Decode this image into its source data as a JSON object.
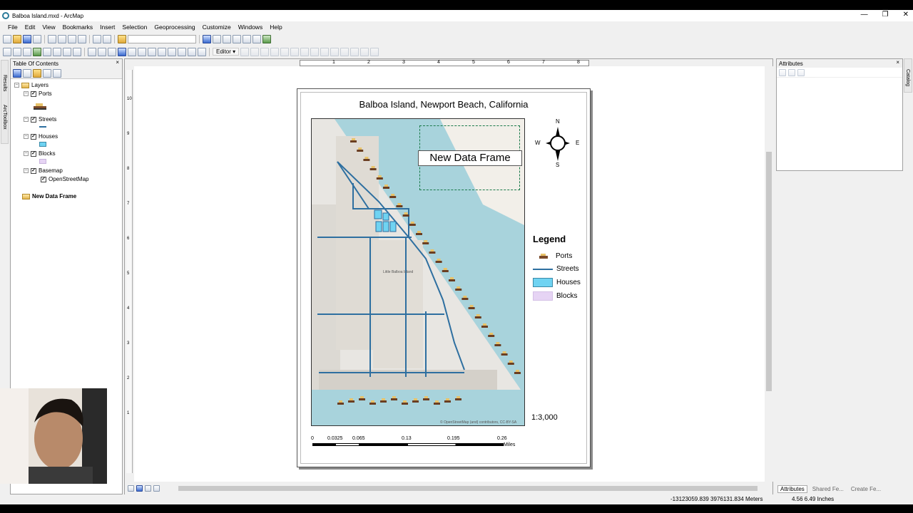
{
  "window": {
    "title": "Balboa Island.mxd - ArcMap"
  },
  "menu": [
    "File",
    "Edit",
    "View",
    "Bookmarks",
    "Insert",
    "Selection",
    "Geoprocessing",
    "Customize",
    "Windows",
    "Help"
  ],
  "toolbar": {
    "editor_label": "Editor ▾"
  },
  "left_tabs": [
    "Results",
    "ArcToolbox"
  ],
  "right_tabs": [
    "Catalog"
  ],
  "toc": {
    "title": "Table Of Contents",
    "layers_root": "Layers",
    "ports": "Ports",
    "streets": "Streets",
    "houses": "Houses",
    "blocks": "Blocks",
    "basemap": "Basemap",
    "openstreetmap": "OpenStreetMap",
    "new_data_frame": "New Data Frame"
  },
  "attributes_panel": {
    "title": "Attributes"
  },
  "layout": {
    "map_title": "Balboa Island, Newport Beach, California",
    "data_frame_label": "New Data Frame",
    "north_arrow": {
      "n": "N",
      "s": "S",
      "e": "E",
      "w": "W"
    },
    "legend_title": "Legend",
    "legend": [
      {
        "label": "Ports",
        "kind": "port"
      },
      {
        "label": "Streets",
        "kind": "line",
        "color": "#2e6fa0"
      },
      {
        "label": "Houses",
        "kind": "box",
        "color": "#6fd3f2"
      },
      {
        "label": "Blocks",
        "kind": "box",
        "color": "#e6d4f4"
      }
    ],
    "scale_text": "1:3,000",
    "scalebar": {
      "ticks": [
        "0",
        "0.0325",
        "0.065",
        "0.13",
        "0.195",
        "0.26"
      ],
      "units": "Miles"
    },
    "attribution": "© OpenStreetMap (and) contributors, CC-BY-SA",
    "map_labels": {
      "island": "Little Balboa Island"
    }
  },
  "ruler_h": [
    "1",
    "2",
    "3",
    "4",
    "5",
    "6",
    "7",
    "8"
  ],
  "ruler_v": [
    "10",
    "9",
    "8",
    "7",
    "6",
    "5",
    "4",
    "3",
    "2",
    "1"
  ],
  "status": {
    "coords": "-13123059.839  3976131.834 Meters",
    "page": "4.56  6.49 Inches"
  },
  "bottom_tabs": [
    "Attributes",
    "Shared Fe...",
    "Create Fe..."
  ]
}
